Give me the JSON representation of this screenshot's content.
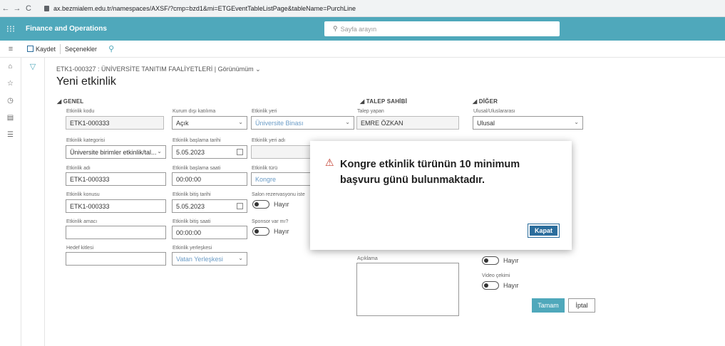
{
  "browser": {
    "url": "ax.bezmialem.edu.tr/namespaces/AXSF/?cmp=bzd1&mi=ETGEventTableListPage&tableName=PurchLine"
  },
  "app": {
    "name": "Finance and Operations",
    "search_placeholder": "Sayfa arayın"
  },
  "toolbar": {
    "save_label": "Kaydet",
    "options_label": "Seçenekler"
  },
  "page": {
    "breadcrumb": "ETK1-000327 : ÜNİVERSİTE TANITIM FAALİYETLERİ  |  Görünümüm",
    "title": "Yeni etkinlik"
  },
  "sections": {
    "genel": "GENEL",
    "talep": "TALEP SAHİBİ",
    "diger": "DİĞER"
  },
  "fields": {
    "etkinlik_kodu": {
      "label": "Etkinlik kodu",
      "value": "ETK1-000333"
    },
    "etkinlik_kategorisi": {
      "label": "Etkinlik kategorisi",
      "value": "Üniversite birimler etkinlik/tal..."
    },
    "etkinlik_adi": {
      "label": "Etkinlik adı",
      "value": "ETK1-000333"
    },
    "etkinlik_konusu": {
      "label": "Etkinlik konusu",
      "value": "ETK1-000333"
    },
    "etkinlik_amaci": {
      "label": "Etkinlik amacı",
      "value": ""
    },
    "hedef_kitlesi": {
      "label": "Hedef kitlesi",
      "value": ""
    },
    "kurum_disi": {
      "label": "Kurum dışı katılıma",
      "value": "Açık"
    },
    "baslama_tarihi": {
      "label": "Etkinlik başlama tarihi",
      "value": "5.05.2023"
    },
    "baslama_saati": {
      "label": "Etkinlik başlama saati",
      "value": "00:00:00"
    },
    "bitis_tarihi": {
      "label": "Etkinlik bitiş tarihi",
      "value": "5.05.2023"
    },
    "bitis_saati": {
      "label": "Etkinlik bitiş saati",
      "value": "00:00:00"
    },
    "yerleskesi": {
      "label": "Etkinlik yerleşkesi",
      "value": "Vatan Yerleşkesi"
    },
    "etkinlik_yeri": {
      "label": "Etkinlik yeri",
      "value": "Üniversite Binası"
    },
    "etkinlik_yeri_adi": {
      "label": "Etkinlik yeri adı",
      "value": ""
    },
    "etkinlik_turu": {
      "label": "Etkinlik türü",
      "value": "Kongre"
    },
    "salon_rezervasyonu": {
      "label": "Salon rezervasyonu iste",
      "value": "Hayır"
    },
    "sponsor": {
      "label": "Sponsor var mı?",
      "value": "Hayır"
    },
    "talep_yapan": {
      "label": "Talep yapan",
      "value": "EMRE ÖZKAN"
    },
    "aciklama": {
      "label": "Açıklama"
    },
    "ulusal": {
      "label": "Ulusal/Uluslararası",
      "value": "Ulusal"
    },
    "toggle_hayir": {
      "value": "Hayır"
    },
    "video_cekimi": {
      "label": "Video çekimi",
      "value": "Hayır"
    }
  },
  "buttons": {
    "ok": "Tamam",
    "cancel": "İptal"
  },
  "dialog": {
    "message": "Kongre etkinlik türünün 10 minimum başvuru günü bulunmaktadır.",
    "close_label": "Kapat"
  }
}
